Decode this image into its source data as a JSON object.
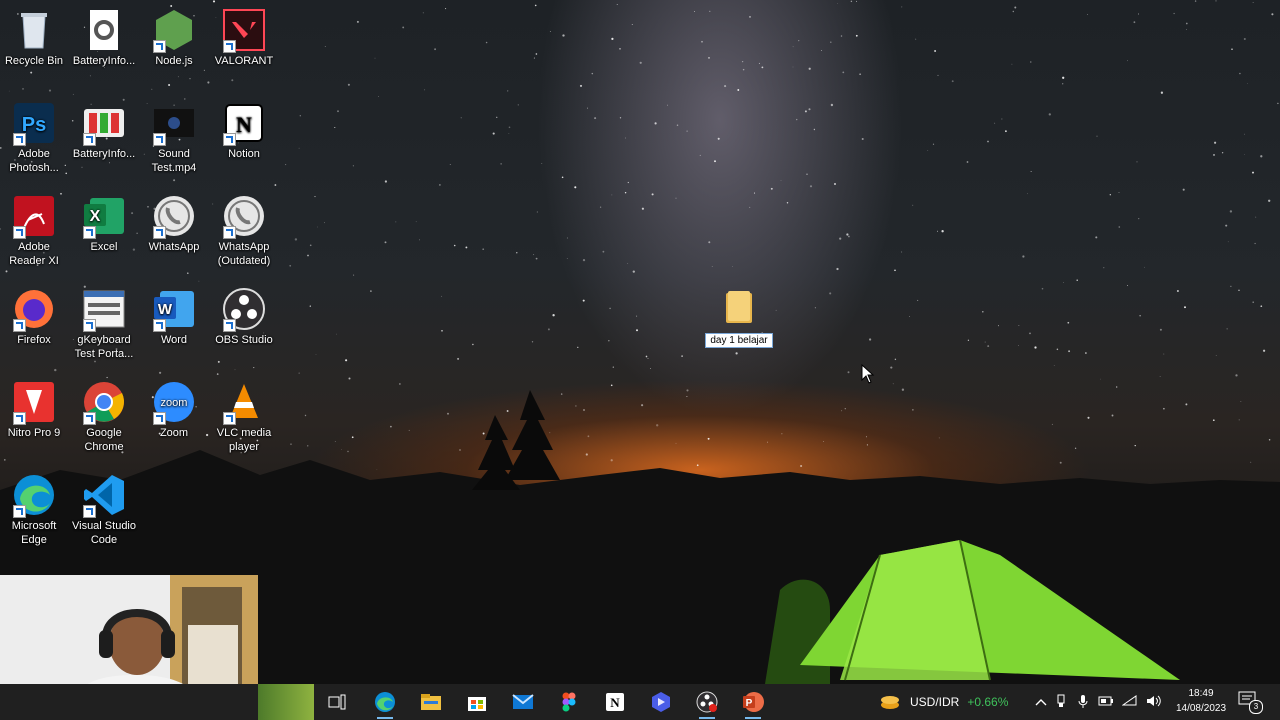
{
  "desktop_icons": [
    {
      "label": "Recycle Bin",
      "icon": "recycle-bin-icon"
    },
    {
      "label": "BatteryInfo...",
      "icon": "settings-file-icon"
    },
    {
      "label": "Node.js",
      "icon": "nodejs-icon"
    },
    {
      "label": "VALORANT",
      "icon": "valorant-icon"
    },
    {
      "label": "Adobe Photosh...",
      "icon": "photoshop-icon"
    },
    {
      "label": "BatteryInfo...",
      "icon": "batteryinfo-icon"
    },
    {
      "label": "Sound Test.mp4",
      "icon": "video-file-icon"
    },
    {
      "label": "Notion",
      "icon": "notion-icon"
    },
    {
      "label": "Adobe Reader XI",
      "icon": "adobe-reader-icon"
    },
    {
      "label": "Excel",
      "icon": "excel-icon"
    },
    {
      "label": "WhatsApp",
      "icon": "whatsapp-icon"
    },
    {
      "label": "WhatsApp (Outdated)",
      "icon": "whatsapp-icon"
    },
    {
      "label": "Firefox",
      "icon": "firefox-icon"
    },
    {
      "label": "gKeyboard Test Porta...",
      "icon": "keyboard-test-icon"
    },
    {
      "label": "Word",
      "icon": "word-icon"
    },
    {
      "label": "OBS Studio",
      "icon": "obs-icon"
    },
    {
      "label": "Nitro Pro 9",
      "icon": "nitro-pdf-icon"
    },
    {
      "label": "Google Chrome",
      "icon": "chrome-icon"
    },
    {
      "label": "Zoom",
      "icon": "zoom-icon"
    },
    {
      "label": "VLC media player",
      "icon": "vlc-icon"
    },
    {
      "label": "Microsoft Edge",
      "icon": "edge-icon"
    },
    {
      "label": "Visual Studio Code",
      "icon": "vscode-icon"
    }
  ],
  "rename_folder": {
    "value": "day 1 belajar",
    "icon": "folder-icon"
  },
  "taskbar": {
    "apps": [
      "task-view-icon",
      "edge-icon",
      "file-explorer-icon",
      "microsoft-store-icon",
      "mail-icon",
      "figma-icon",
      "notion-icon",
      "copilot-icon",
      "obs-icon",
      "powerpoint-icon"
    ],
    "ticker": {
      "symbol": "USD/IDR",
      "change": "+0.66%",
      "change_color": "#3fc15b"
    },
    "clock": {
      "time": "18:49",
      "date": "14/08/2023"
    },
    "notification_count": "3"
  }
}
